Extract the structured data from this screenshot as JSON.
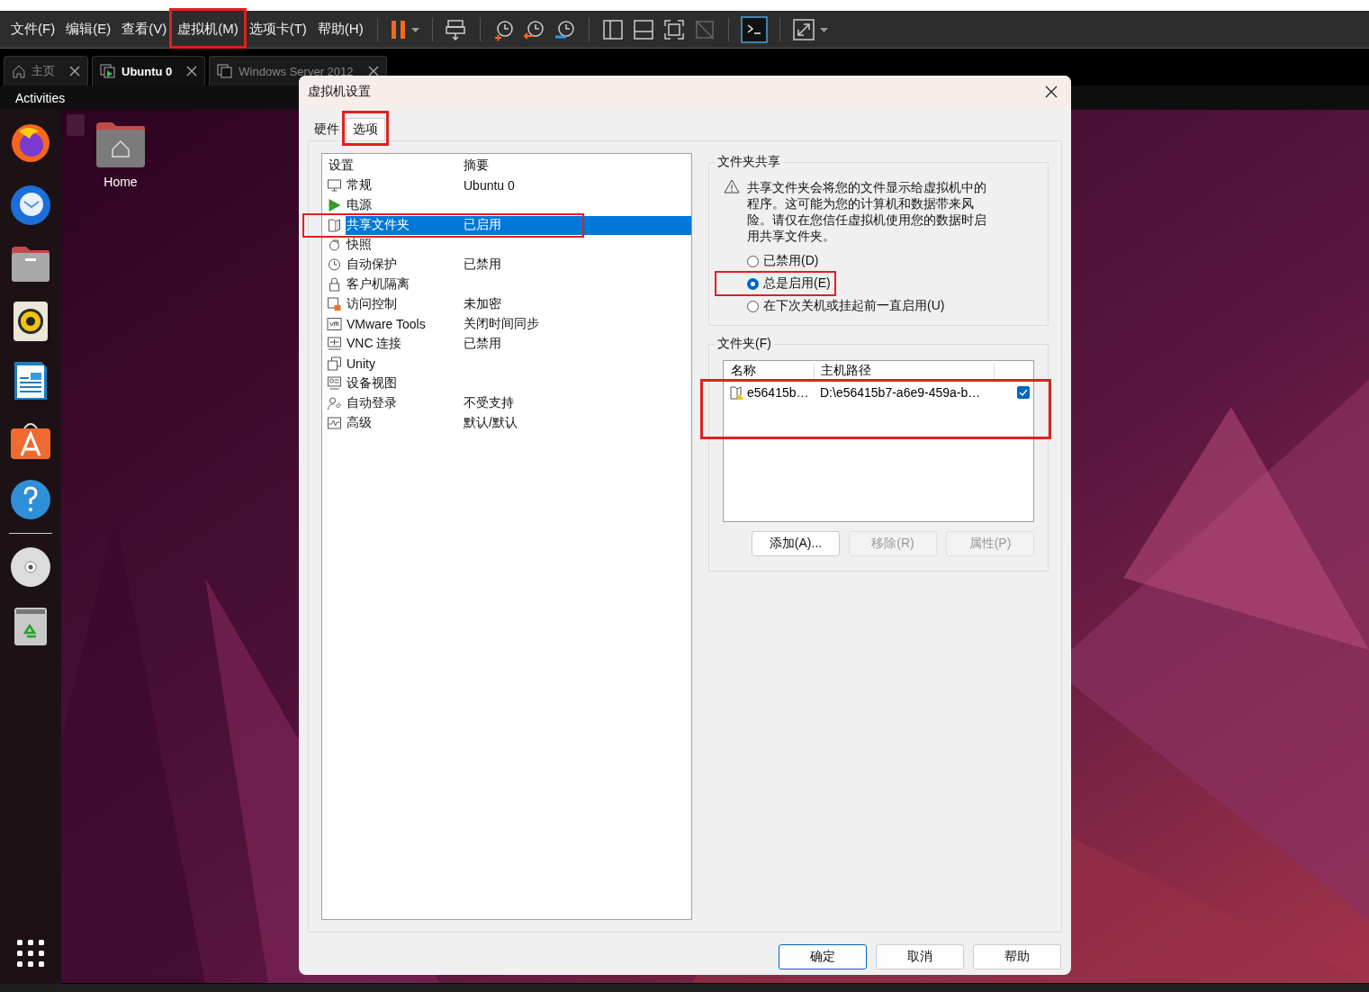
{
  "menu_bar": {
    "items": [
      "文件(F)",
      "编辑(E)",
      "查看(V)",
      "虚拟机(M)",
      "选项卡(T)",
      "帮助(H)"
    ]
  },
  "vm_tabs": [
    {
      "label": "主页",
      "selected": false
    },
    {
      "label": "Ubuntu 0",
      "selected": true
    },
    {
      "label": "Windows Server 2012",
      "selected": false
    }
  ],
  "guest": {
    "top_bar": "Activities",
    "desktop_icons": [
      {
        "label": "Home"
      }
    ]
  },
  "dialog": {
    "title": "虚拟机设置",
    "tabs": [
      {
        "label": "硬件",
        "selected": false
      },
      {
        "label": "选项",
        "selected": true
      }
    ],
    "settings": {
      "columns": [
        "设置",
        "摘要"
      ],
      "rows": [
        {
          "name": "常规",
          "summary": "Ubuntu 0",
          "selected": false
        },
        {
          "name": "电源",
          "selected": false
        },
        {
          "name": "共享文件夹",
          "summary": "已启用",
          "selected": true
        },
        {
          "name": "快照",
          "selected": false
        },
        {
          "name": "自动保护",
          "summary": "已禁用",
          "selected": false
        },
        {
          "name": "客户机隔离",
          "selected": false
        },
        {
          "name": "访问控制",
          "summary": "未加密",
          "selected": false
        },
        {
          "name": "VMware Tools",
          "summary": "关闭时间同步",
          "selected": false
        },
        {
          "name": "VNC 连接",
          "summary": "已禁用",
          "selected": false
        },
        {
          "name": "Unity",
          "selected": false
        },
        {
          "name": "设备视图",
          "selected": false
        },
        {
          "name": "自动登录",
          "summary": "不受支持",
          "selected": false
        },
        {
          "name": "高级",
          "summary": "默认/默认",
          "selected": false
        }
      ]
    },
    "sharing": {
      "title": "文件夹共享",
      "warning": "共享文件夹会将您的文件显示给虚拟机中的程序。这可能为您的计算机和数据带来风险。请仅在您信任虚拟机使用您的数据时启用共享文件夹。",
      "options": [
        {
          "label": "已禁用(D)",
          "selected": false
        },
        {
          "label": "总是启用(E)",
          "selected": true
        },
        {
          "label": "在下次关机或挂起前一直启用(U)",
          "selected": false
        }
      ]
    },
    "folders": {
      "title": "文件夹(F)",
      "columns": [
        "名称",
        "主机路径"
      ],
      "rows": [
        {
          "name": "e56415b…",
          "path": "D:\\e56415b7-a6e9-459a-b…",
          "checked": true
        }
      ],
      "buttons": [
        {
          "label": "添加(A)...",
          "disabled": false
        },
        {
          "label": "移除(R)",
          "disabled": true
        },
        {
          "label": "属性(P)",
          "disabled": true
        }
      ]
    },
    "buttons": [
      {
        "label": "确定",
        "default": true
      },
      {
        "label": "取消",
        "default": false
      },
      {
        "label": "帮助",
        "default": false
      }
    ]
  }
}
